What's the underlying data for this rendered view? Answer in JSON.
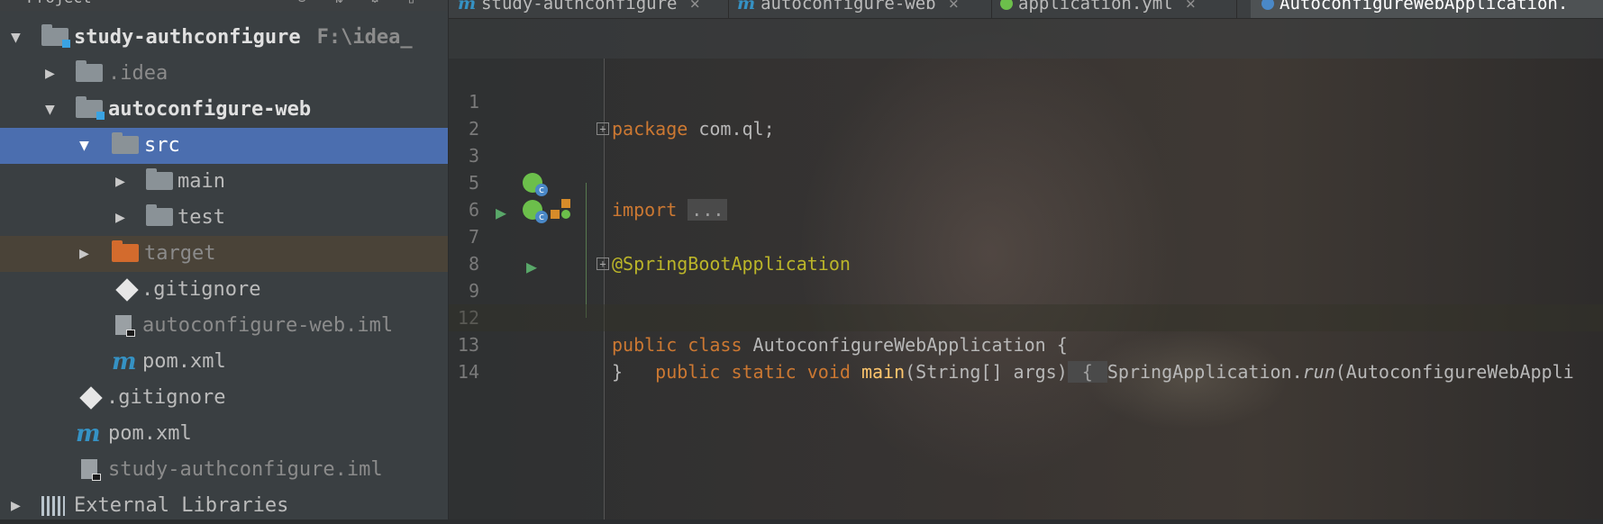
{
  "project_panel": {
    "title": "Project",
    "items": [
      {
        "label": "study-authconfigure",
        "path": "F:\\idea_"
      },
      {
        "label": ".idea"
      },
      {
        "label": "autoconfigure-web"
      },
      {
        "label": "src"
      },
      {
        "label": "main"
      },
      {
        "label": "test"
      },
      {
        "label": "target"
      },
      {
        "label": ".gitignore"
      },
      {
        "label": "autoconfigure-web.iml"
      },
      {
        "label": "pom.xml"
      },
      {
        "label": ".gitignore"
      },
      {
        "label": "pom.xml"
      },
      {
        "label": "study-authconfigure.iml"
      },
      {
        "label": "External Libraries"
      }
    ]
  },
  "tabs": [
    {
      "label": "study-authconfigure",
      "icon": "maven-icon"
    },
    {
      "label": "autoconfigure-web",
      "icon": "maven-icon"
    },
    {
      "label": "application.yml",
      "icon": "spring-config-icon"
    },
    {
      "label": "AutoconfigureWebApplication.",
      "icon": "spring-class-icon",
      "active": true
    }
  ],
  "editor": {
    "lines": [
      {
        "num": "1",
        "parts": [
          "package",
          " com.ql;"
        ]
      },
      {
        "num": "2"
      },
      {
        "num": "3",
        "parts": [
          "import",
          " ",
          "..."
        ]
      },
      {
        "num": "5"
      },
      {
        "num": "6",
        "parts": [
          "@SpringBootApplication"
        ]
      },
      {
        "num": "7",
        "parts": [
          "public class",
          " AutoconfigureWebApplication {"
        ]
      },
      {
        "num": "8"
      },
      {
        "num": "9",
        "parts": [
          "    ",
          "public static void",
          " ",
          "main",
          "(String[] args)",
          " { ",
          "SpringApplication.",
          "run",
          "(AutoconfigureWebAppli"
        ]
      },
      {
        "num": "12"
      },
      {
        "num": "13",
        "parts": [
          "}"
        ]
      },
      {
        "num": "14"
      }
    ]
  }
}
